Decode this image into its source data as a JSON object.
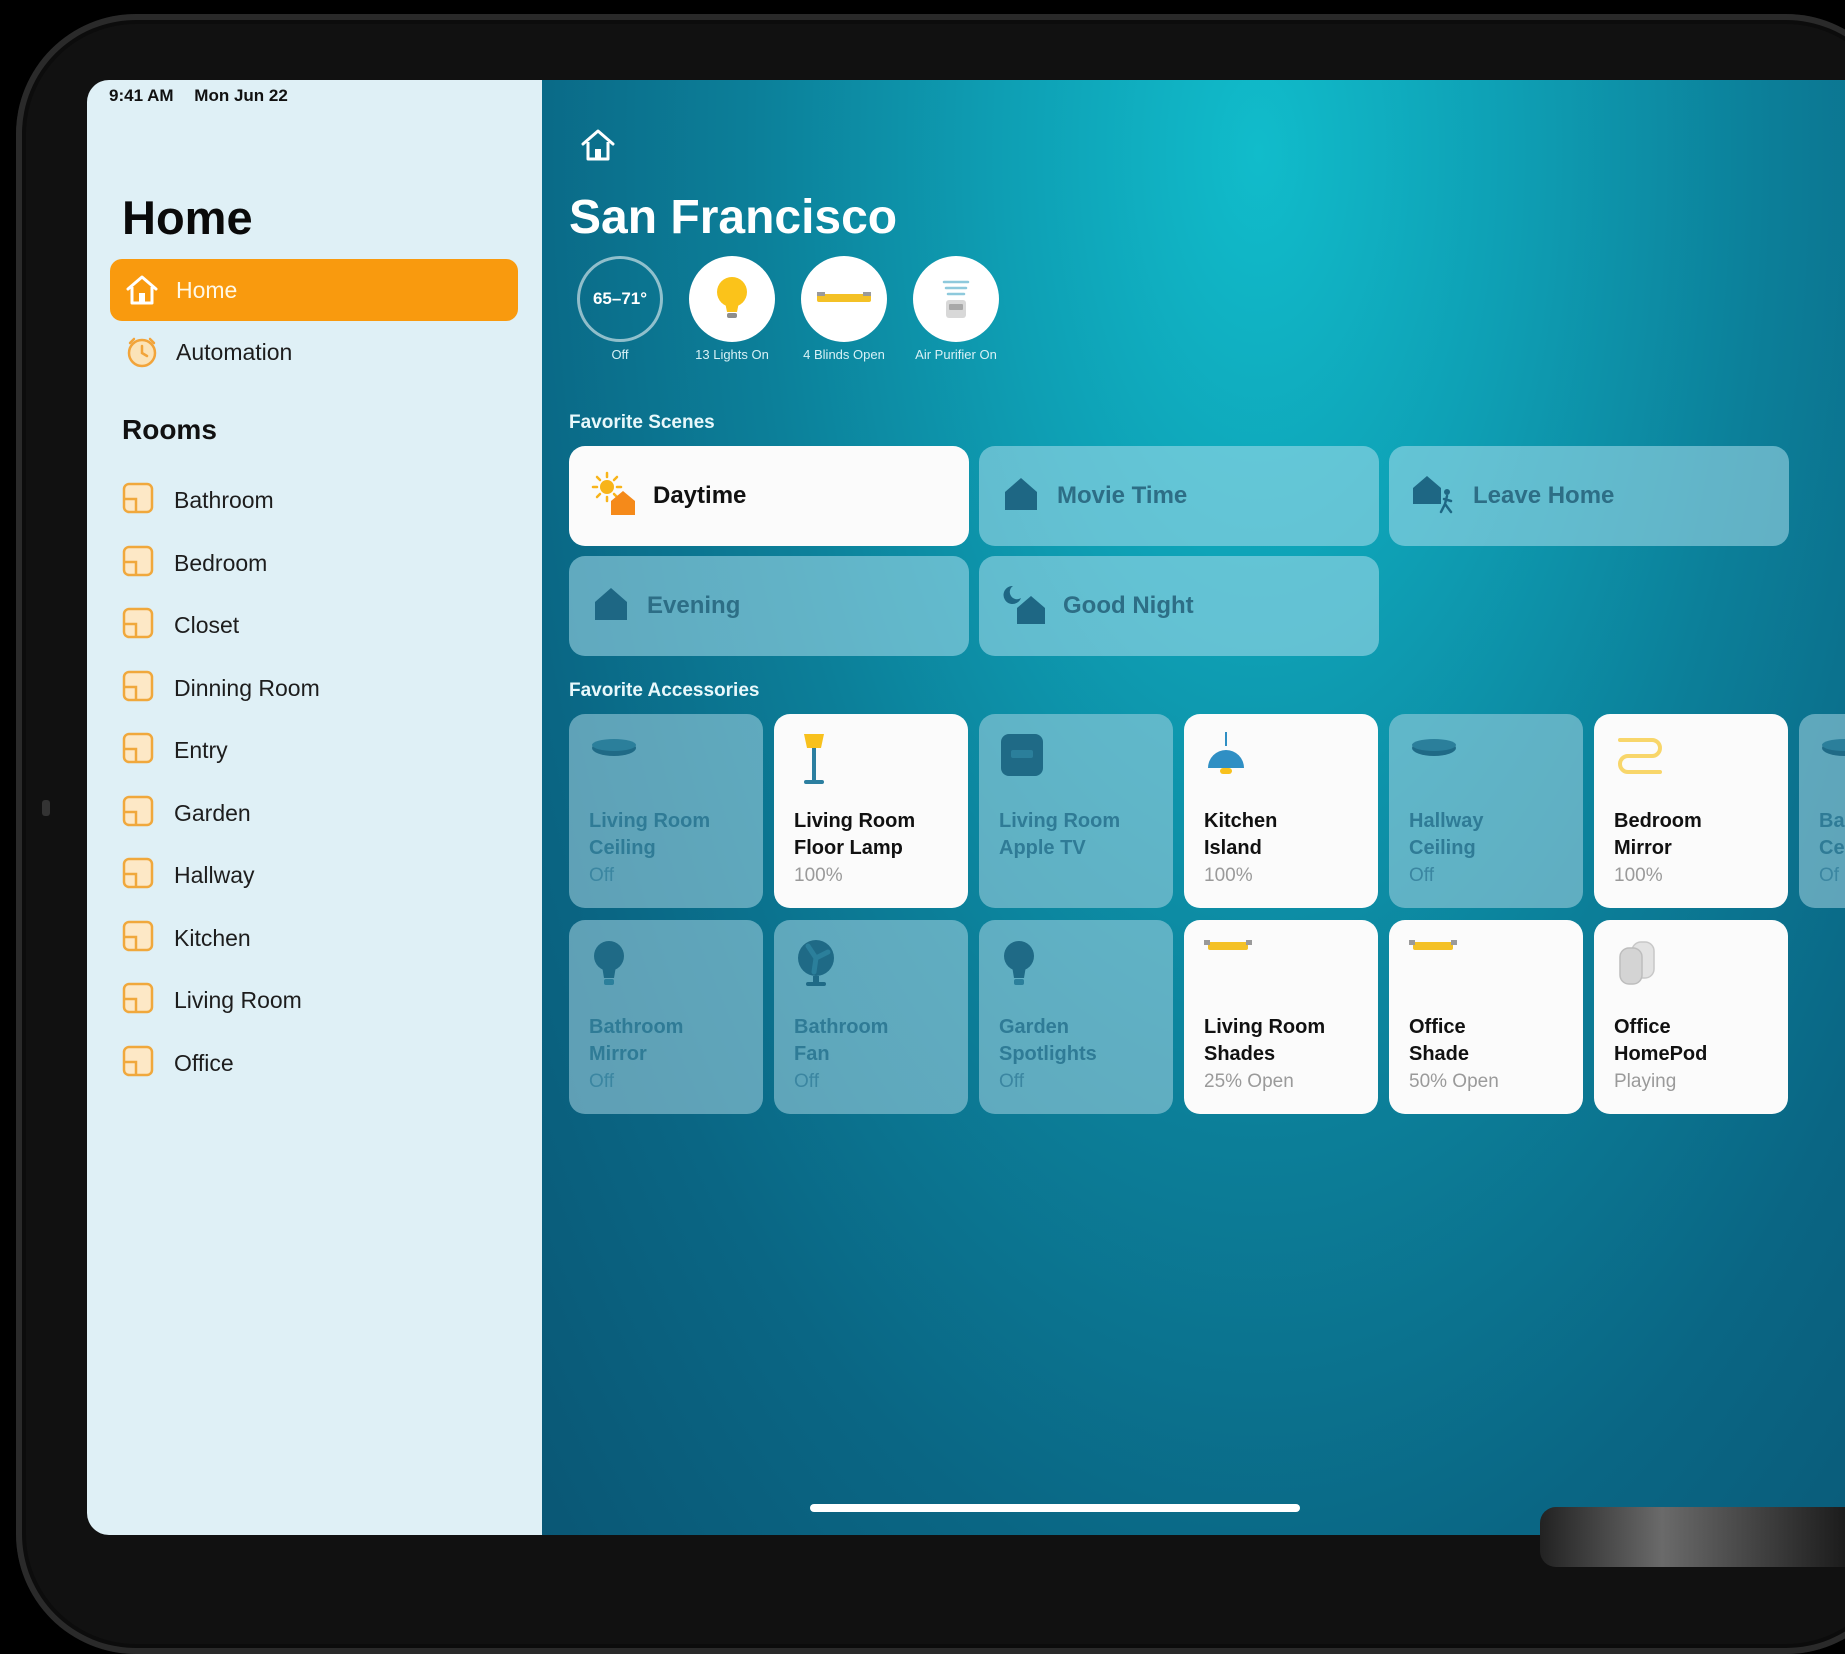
{
  "status_bar": {
    "time": "9:41 AM",
    "date": "Mon Jun 22"
  },
  "sidebar": {
    "title": "Home",
    "nav": [
      {
        "label": "Home",
        "icon": "house-icon",
        "active": true
      },
      {
        "label": "Automation",
        "icon": "clock-icon",
        "active": false
      }
    ],
    "rooms_title": "Rooms",
    "rooms": [
      "Bathroom",
      "Bedroom",
      "Closet",
      "Dinning Room",
      "Entry",
      "Garden",
      "Hallway",
      "Kitchen",
      "Living Room",
      "Office"
    ]
  },
  "main": {
    "title": "San Francisco",
    "status": [
      {
        "value": "65–71°",
        "caption": "Off",
        "icon": "thermostat-icon"
      },
      {
        "caption": "13 Lights On",
        "icon": "lightbulb-icon"
      },
      {
        "caption": "4 Blinds Open",
        "icon": "blinds-icon"
      },
      {
        "caption": "Air Purifier On",
        "icon": "air-purifier-icon"
      }
    ],
    "scenes_title": "Favorite Scenes",
    "scenes": [
      {
        "label": "Daytime",
        "icon": "daytime-scene-icon",
        "on": true
      },
      {
        "label": "Movie Time",
        "icon": "house-scene-icon",
        "on": false
      },
      {
        "label": "Leave Home",
        "icon": "leave-home-icon",
        "on": false
      },
      {
        "label": "Evening",
        "icon": "house-scene-icon",
        "on": false
      },
      {
        "label": "Good Night",
        "icon": "good-night-icon",
        "on": false
      }
    ],
    "accessories_title": "Favorite Accessories",
    "accessories": [
      {
        "name1": "Living Room",
        "name2": "Ceiling",
        "status": "Off",
        "on": false,
        "icon": "ceiling-light-icon"
      },
      {
        "name1": "Living Room",
        "name2": "Floor Lamp",
        "status": "100%",
        "on": true,
        "icon": "floor-lamp-icon"
      },
      {
        "name1": "Living Room",
        "name2": "Apple TV",
        "status": "",
        "on": false,
        "icon": "apple-tv-icon"
      },
      {
        "name1": "Kitchen",
        "name2": "Island",
        "status": "100%",
        "on": true,
        "icon": "pendant-light-icon"
      },
      {
        "name1": "Hallway",
        "name2": "Ceiling",
        "status": "Off",
        "on": false,
        "icon": "ceiling-light-icon"
      },
      {
        "name1": "Bedroom",
        "name2": "Mirror",
        "status": "100%",
        "on": true,
        "icon": "light-strip-icon"
      },
      {
        "name1": "Ba",
        "name2": "Ce",
        "status": "Of",
        "on": false,
        "icon": "ceiling-light-icon"
      },
      {
        "name1": "Bathroom",
        "name2": "Mirror",
        "status": "Off",
        "on": false,
        "icon": "bulb-icon"
      },
      {
        "name1": "Bathroom",
        "name2": "Fan",
        "status": "Off",
        "on": false,
        "icon": "fan-icon"
      },
      {
        "name1": "Garden",
        "name2": "Spotlights",
        "status": "Off",
        "on": false,
        "icon": "bulb-icon"
      },
      {
        "name1": "Living Room",
        "name2": "Shades",
        "status": "25% Open",
        "on": true,
        "icon": "shades-icon"
      },
      {
        "name1": "Office",
        "name2": "Shade",
        "status": "50% Open",
        "on": true,
        "icon": "shades-icon"
      },
      {
        "name1": "Office",
        "name2": "HomePod",
        "status": "Playing",
        "on": true,
        "icon": "homepod-icon"
      }
    ]
  },
  "colors": {
    "accent": "#f99a0e",
    "sidebar_bg": "#dff0f6",
    "main_bg": "#0c7f99"
  }
}
